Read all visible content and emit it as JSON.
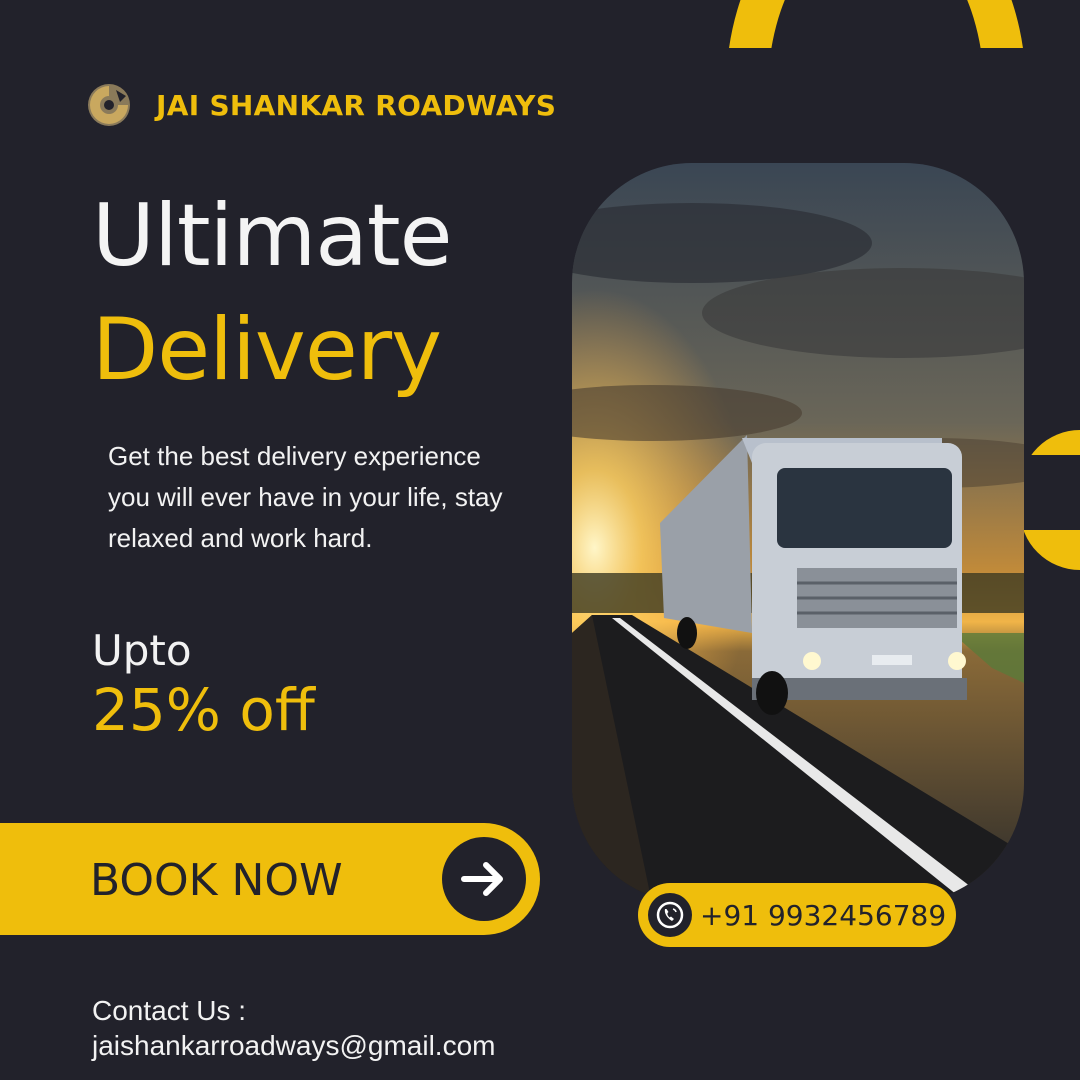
{
  "brand": {
    "name": "JAI SHANKAR ROADWAYS",
    "logo_icon": "circular-c-logo-icon"
  },
  "headline": {
    "line1": "Ultimate",
    "line2": "Delivery"
  },
  "description": "Get the best delivery experience you will ever have in your life, stay relaxed and work hard.",
  "offer": {
    "prefix": "Upto",
    "value": "25% off"
  },
  "cta": {
    "label": "BOOK NOW",
    "icon": "arrow-right-icon"
  },
  "phone": {
    "number": "+91 9932456789",
    "icon": "phone-call-icon"
  },
  "contact": {
    "label": "Contact Us :",
    "email": "jaishankarroadways@gmail.com"
  },
  "colors": {
    "background": "#22222b",
    "accent": "#efbe0c",
    "text": "#f2f2f2"
  }
}
